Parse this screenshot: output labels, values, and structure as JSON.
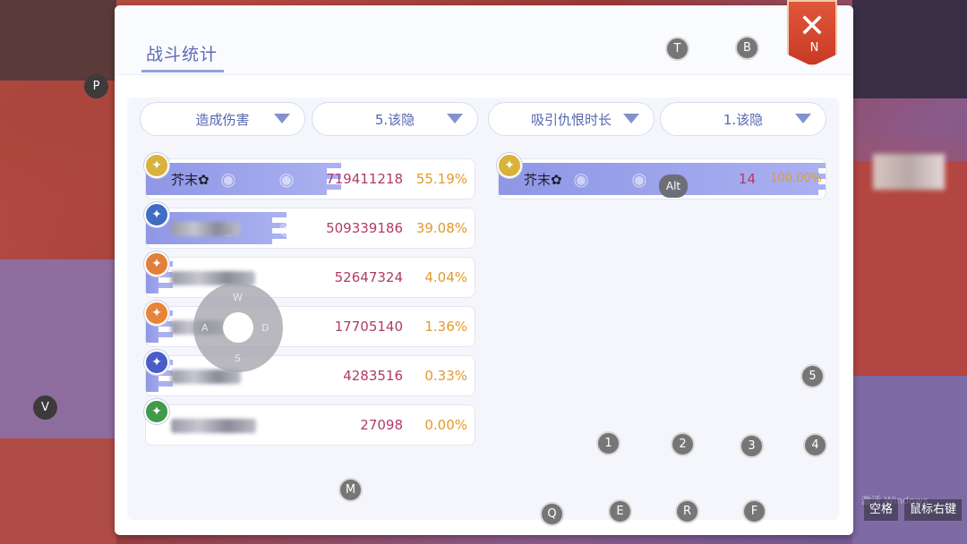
{
  "window": {
    "title": "战斗统计",
    "close_label": "✕"
  },
  "filters": {
    "left_category": "造成伤害",
    "left_target": "5.该隐",
    "right_category": "吸引仇恨时长",
    "right_target": "1.该隐"
  },
  "damage_rows": [
    {
      "name": "芥末✿",
      "value": "719411218",
      "percent": "55.19%",
      "fraction": 0.5519,
      "avatar_color": "#d8b23a",
      "avatar_icon": "sun-emblem-icon"
    },
    {
      "name": "",
      "value": "509339186",
      "percent": "39.08%",
      "fraction": 0.3908,
      "avatar_color": "#3f6cc4",
      "avatar_icon": "anchor-emblem-icon"
    },
    {
      "name": "",
      "value": "52647324",
      "percent": "4.04%",
      "fraction": 0.0404,
      "avatar_color": "#e0803a",
      "avatar_icon": "leaf-emblem-icon"
    },
    {
      "name": "",
      "value": "17705140",
      "percent": "1.36%",
      "fraction": 0.0136,
      "avatar_color": "#e8843a",
      "avatar_icon": "flame-emblem-icon"
    },
    {
      "name": "",
      "value": "4283516",
      "percent": "0.33%",
      "fraction": 0.0033,
      "avatar_color": "#4a5cc8",
      "avatar_icon": "wing-emblem-icon"
    },
    {
      "name": "",
      "value": "27098",
      "percent": "0.00%",
      "fraction": 0.0,
      "avatar_color": "#3f9a4a",
      "avatar_icon": "tree-emblem-icon"
    }
  ],
  "aggro_rows": [
    {
      "name": "芥末✿",
      "value": "14",
      "percent": "100.00%",
      "fraction": 1.0,
      "avatar_color": "#d8b23a",
      "avatar_icon": "sun-emblem-icon"
    }
  ],
  "hotkeys": {
    "P": "P",
    "T": "T",
    "B": "B",
    "N": "N",
    "V": "V",
    "M": "M",
    "Q": "Q",
    "E": "E",
    "R": "R",
    "F": "F",
    "k1": "1",
    "k2": "2",
    "k3": "3",
    "k4": "4",
    "k5": "5",
    "alt": "Alt",
    "space": "空格",
    "right_click": "鼠标右键"
  },
  "joystick": {
    "w": "W",
    "a": "A",
    "s": "S",
    "d": "D"
  },
  "watermark": "激活 Windows"
}
